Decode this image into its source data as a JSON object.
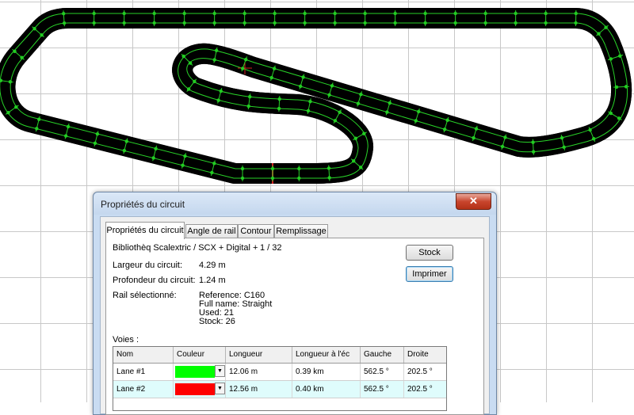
{
  "colors": {
    "track": "#000000",
    "lane_line": "#28d228",
    "joint_dot": "#22cc22",
    "edge_line": "#d22020",
    "lane1": "#00ff00",
    "lane2": "#ff0000",
    "selected_row": "#dffcfc"
  },
  "dialog": {
    "title": "Propriétés du circuit",
    "close_icon": "✕",
    "tabs": [
      "Propriétés du circuit",
      "Angle de rail",
      "Contour",
      "Remplissage"
    ],
    "library_label": "Bibliothèq Scalextric / SCX + Digital +",
    "library_page": "1 / 32",
    "width_label": "Largeur du circuit:",
    "width_value": "4.29 m",
    "depth_label": "Profondeur du circuit:",
    "depth_value": "1.24 m",
    "rail_label": "Rail sélectionné:",
    "rail_reference": "Reference: C160",
    "rail_fullname": "Full name: Straight",
    "rail_used": "Used: 21",
    "rail_stock": "Stock: 26",
    "stock_button": "Stock",
    "print_button": "Imprimer",
    "lanes_label": "Voies :",
    "lanes_columns": [
      "Nom",
      "Couleur",
      "Longueur",
      "Longueur à l'éc",
      "Gauche",
      "Droite"
    ],
    "lanes": [
      {
        "name": "Lane #1",
        "color": "#00ff00",
        "length": "12.06 m",
        "scale_length": "0.39 km",
        "left": "562.5 °",
        "right": "202.5 °"
      },
      {
        "name": "Lane #2",
        "color": "#ff0000",
        "length": "12.56 m",
        "scale_length": "0.40 km",
        "left": "562.5 °",
        "right": "202.5 °"
      }
    ]
  }
}
